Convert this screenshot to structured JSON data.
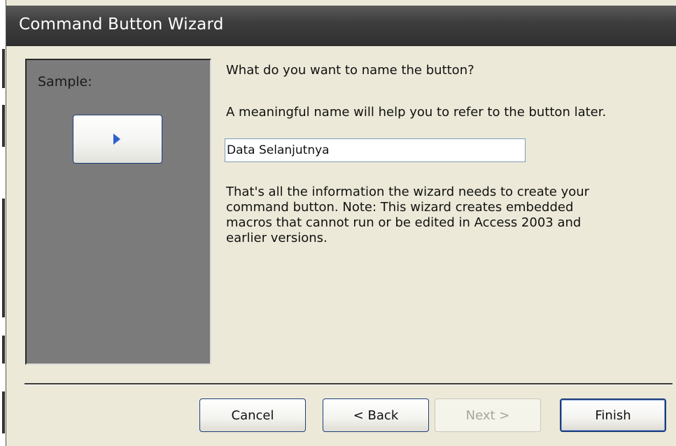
{
  "window": {
    "title": "Command Button Wizard"
  },
  "sample": {
    "label": "Sample:",
    "button_icon": "play-arrow-icon"
  },
  "content": {
    "question": "What do you want to name the button?",
    "hint": "A meaningful name will help you to refer to the button later.",
    "name_value": "Data Selanjutnya",
    "info": "That's all the information the wizard needs to create your command button. Note: This wizard creates embedded macros that cannot run or be edited in Access 2003 and earlier versions."
  },
  "buttons": {
    "cancel": "Cancel",
    "back": "< Back",
    "next": "Next >",
    "finish": "Finish"
  },
  "colors": {
    "titlebar": "#3e3e3e",
    "dialog_bg": "#ece9d8",
    "sample_bg": "#7b7b7b",
    "arrow": "#2f5fd0"
  }
}
